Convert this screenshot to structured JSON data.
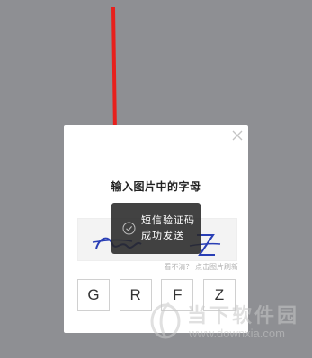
{
  "dialog": {
    "title": "输入图片中的字母",
    "refresh_hint": "看不清？",
    "refresh_link": "点击图片刷新",
    "letters": [
      "G",
      "R",
      "F",
      "Z"
    ]
  },
  "toast": {
    "line1": "短信验证码",
    "line2": "成功发送"
  },
  "watermark": {
    "text": "当下软件园",
    "url": "www.downxia.com"
  },
  "colors": {
    "background": "#8e8f93",
    "arrow": "#e8201c",
    "captcha_ink": "#2a3fb5"
  }
}
